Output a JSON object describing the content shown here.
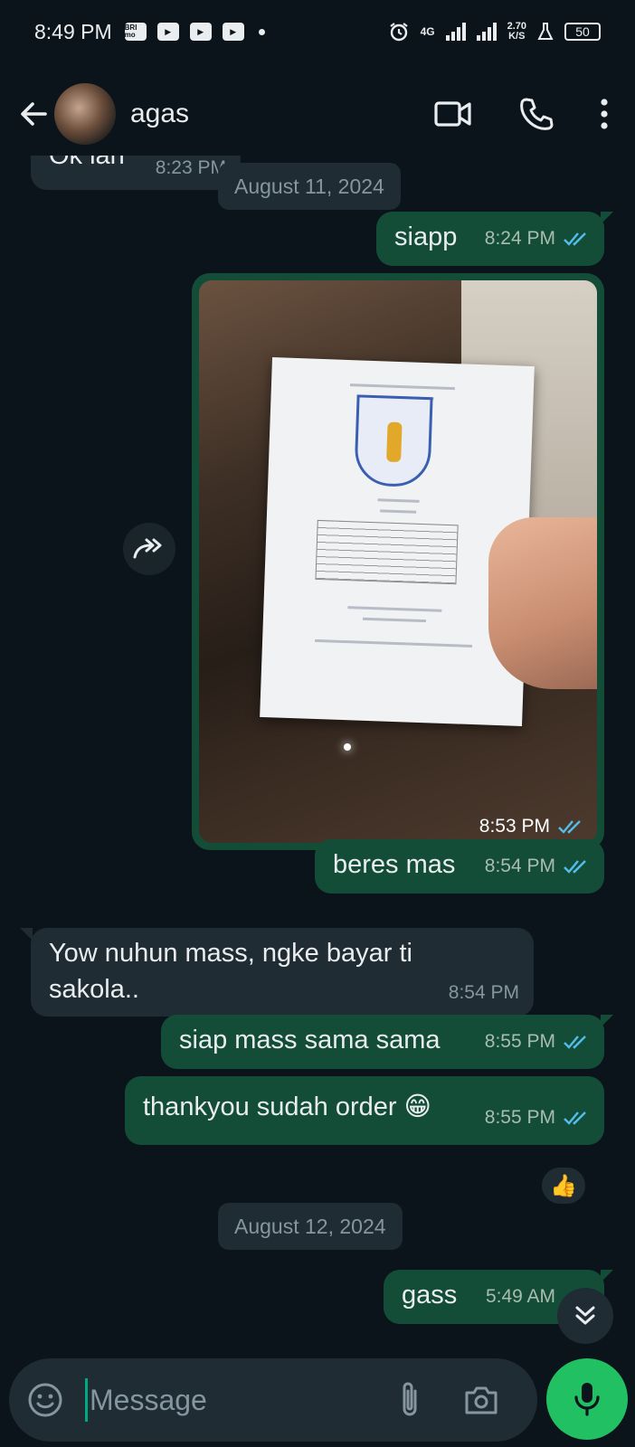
{
  "status_bar": {
    "time": "8:49 PM",
    "app_badge": "BRI mo",
    "network_type": "4G",
    "speed_value": "2.70",
    "speed_unit": "K/S",
    "battery": "50"
  },
  "header": {
    "contact_name": "agas",
    "icons": [
      "back-arrow-icon",
      "video-call-icon",
      "phone-icon",
      "more-vert-icon"
    ]
  },
  "chat": {
    "partial_message": {
      "text": "Ok lah",
      "time": "8:23 PM"
    },
    "date_1": "August 11, 2024",
    "msg_siapp": {
      "text": "siapp",
      "time": "8:24 PM"
    },
    "photo_message": {
      "time": "8:53 PM"
    },
    "msg_beres": {
      "text": "beres mas",
      "time": "8:54 PM"
    },
    "msg_yow": {
      "text": "Yow nuhun mass, ngke bayar ti sakola..",
      "time": "8:54 PM"
    },
    "msg_siap_mass": {
      "text": "siap mass sama sama",
      "time": "8:55 PM"
    },
    "msg_thankyou": {
      "text": "thankyou sudah order 😁",
      "time": "8:55 PM"
    },
    "reaction": "👍",
    "date_2": "August 12, 2024",
    "msg_gass": {
      "text": "gass",
      "time": "5:49 AM"
    }
  },
  "input": {
    "placeholder": "Message"
  },
  "colors": {
    "background": "#0b141a",
    "outgoing_bubble": "#144d37",
    "incoming_bubble": "#202c33",
    "accent_green": "#21c063",
    "read_ticks": "#53bdeb"
  }
}
